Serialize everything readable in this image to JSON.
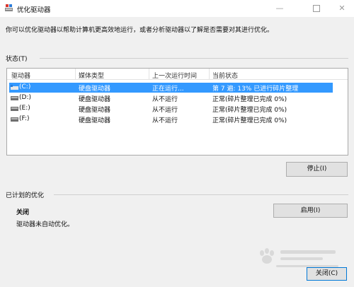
{
  "window": {
    "title": "优化驱动器",
    "minimize_glyph": "—",
    "close_glyph": "✕"
  },
  "description": "你可以优化驱动器以帮助计算机更高效地运行，或者分析驱动器以了解是否需要对其进行优化。",
  "status": {
    "label": "状态(T)",
    "columns": [
      "驱动器",
      "媒体类型",
      "上一次运行时间",
      "当前状态"
    ],
    "rows": [
      {
        "drive": "(C:)",
        "media": "硬盘驱动器",
        "last_run": "正在运行...",
        "status": "第 7 遍: 13% 已进行碎片整理",
        "selected": true,
        "icon": "windows-drive-icon"
      },
      {
        "drive": "(D:)",
        "media": "硬盘驱动器",
        "last_run": "从不运行",
        "status": "正常(碎片整理已完成 0%)",
        "selected": false,
        "icon": "drive-icon"
      },
      {
        "drive": "(E:)",
        "media": "硬盘驱动器",
        "last_run": "从不运行",
        "status": "正常(碎片整理已完成 0%)",
        "selected": false,
        "icon": "drive-icon"
      },
      {
        "drive": "(F:)",
        "media": "硬盘驱动器",
        "last_run": "从不运行",
        "status": "正常(碎片整理已完成 0%)",
        "selected": false,
        "icon": "drive-icon"
      }
    ],
    "stop_button": "停止(I)"
  },
  "schedule": {
    "label": "已计划的优化",
    "state": "关闭",
    "detail": "驱动器未自动优化。",
    "enable_button": "启用(I)"
  },
  "close_button": "关闭(C)",
  "colors": {
    "selection": "#3399ff",
    "background": "#f0f0f0"
  }
}
